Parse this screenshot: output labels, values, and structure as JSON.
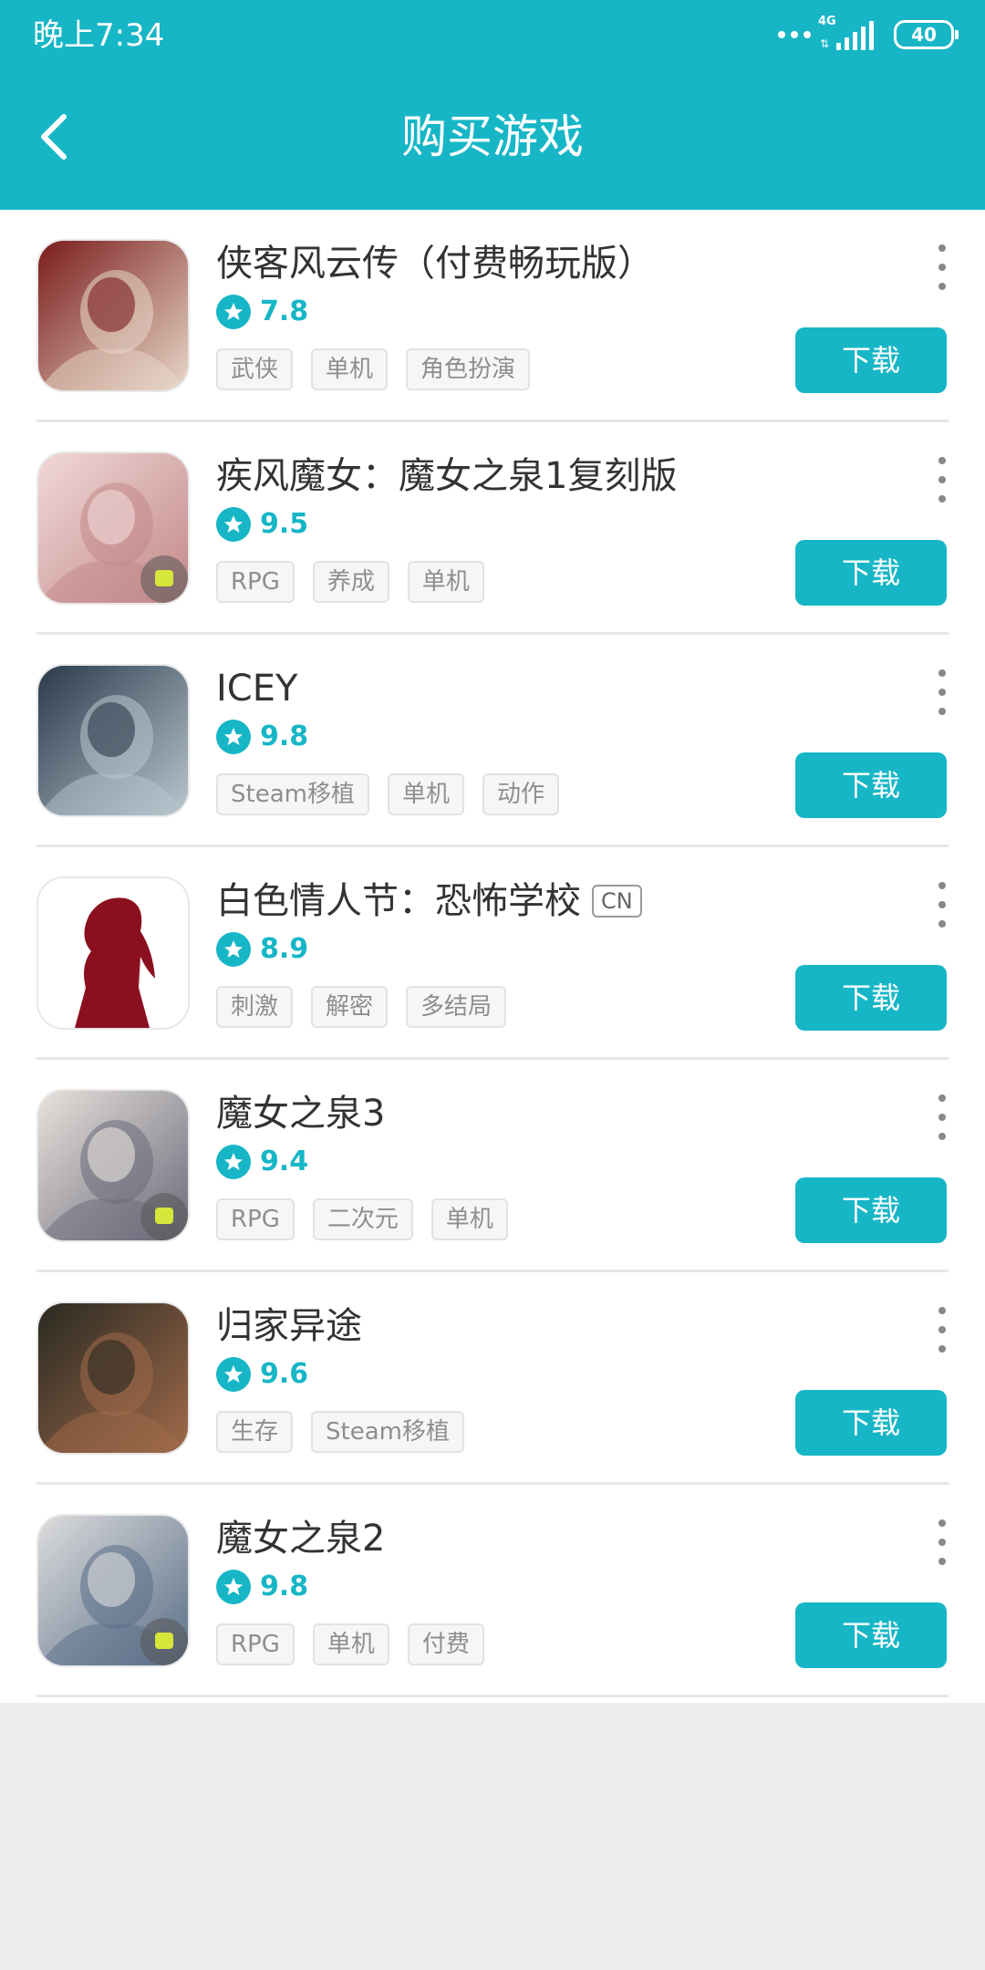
{
  "status_bar": {
    "time": "晚上7:34",
    "network": "4G",
    "battery": "40"
  },
  "header": {
    "title": "购买游戏",
    "back_icon": "chevron-left-icon"
  },
  "download_label": "下载",
  "colors": {
    "accent": "#17b6c6",
    "tag_text": "#8e8e8e",
    "title_text": "#333333"
  },
  "games": [
    {
      "title": "侠客风云传（付费畅玩版）",
      "rating": "7.8",
      "tags": [
        "武侠",
        "单机",
        "角色扮演"
      ],
      "icon": "wuxia-warrior-art",
      "icon_colors": [
        "#7a1c1c",
        "#e8d8c8"
      ]
    },
    {
      "title": "疾风魔女：魔女之泉1复刻版",
      "rating": "9.5",
      "tags": [
        "RPG",
        "养成",
        "单机"
      ],
      "icon": "anime-witch-art",
      "icon_colors": [
        "#f1d8d8",
        "#c28888"
      ]
    },
    {
      "title": "ICEY",
      "rating": "9.8",
      "tags": [
        "Steam移植",
        "单机",
        "动作"
      ],
      "icon": "icey-anime-girl-art",
      "icon_colors": [
        "#2a3a4a",
        "#b8c6cf"
      ]
    },
    {
      "title": "白色情人节：恐怖学校",
      "badge": "CN",
      "rating": "8.9",
      "tags": [
        "刺激",
        "解密",
        "多结局"
      ],
      "icon": "red-silhouette-art",
      "icon_colors": [
        "#ffffff",
        "#8a1020"
      ]
    },
    {
      "title": "魔女之泉3",
      "rating": "9.4",
      "tags": [
        "RPG",
        "二次元",
        "单机"
      ],
      "icon": "white-hair-witch-art",
      "icon_colors": [
        "#e8e2dc",
        "#6a6a7a"
      ]
    },
    {
      "title": "归家异途",
      "rating": "9.6",
      "tags": [
        "生存",
        "Steam移植"
      ],
      "icon": "bearded-man-portrait-art",
      "icon_colors": [
        "#2a2a22",
        "#a06a4a"
      ]
    },
    {
      "title": "魔女之泉2",
      "rating": "9.8",
      "tags": [
        "RPG",
        "单机",
        "付费"
      ],
      "icon": "witch-archer-art",
      "icon_colors": [
        "#dcdcdc",
        "#5a6e88"
      ]
    }
  ]
}
